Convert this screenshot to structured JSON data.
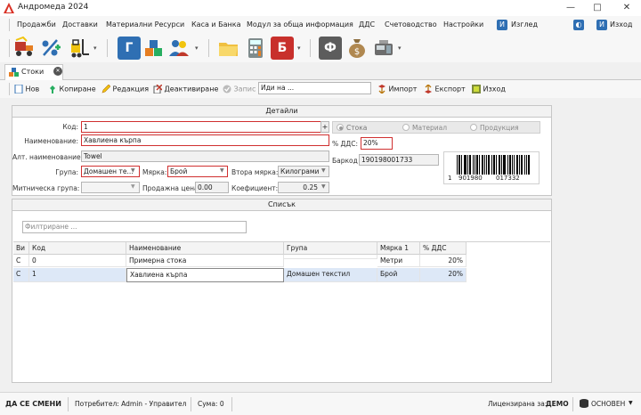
{
  "window": {
    "title": "Андромеда 2024",
    "minimize": "—",
    "maximize": "□",
    "close": "✕"
  },
  "menu": {
    "items": [
      "Продажби",
      "Доставки",
      "Материални Ресурси",
      "Каса и Банка",
      "Модул за обща информация",
      "ДДС",
      "Счетоводство",
      "Настройки"
    ],
    "view_label": "Изглед",
    "exit_label": "Изход"
  },
  "toolbar": {
    "g_letter": "Г",
    "b_letter": "Б",
    "f_letter": "Ф",
    "dropdown": "▾"
  },
  "tab": {
    "label": "Стоки",
    "close": "✕"
  },
  "actions": {
    "new": "Нов",
    "copy": "Копиране",
    "edit": "Редакция",
    "deactivate": "Деактивиране",
    "save": "Запис",
    "search_placeholder": "Иди на ...",
    "import": "Импорт",
    "export": "Експорт",
    "exit": "Изход"
  },
  "details": {
    "title": "Детайли",
    "code_label": "Код:",
    "code_value": "1",
    "name_label": "Наименование:",
    "name_value": "Хавлиена кърпа",
    "alt_name_label": "Алт. наименование:",
    "alt_name_value": "Towel",
    "group_label": "Група:",
    "group_value": "Домашен те...",
    "unit_label": "Мярка:",
    "unit_value": "Брой",
    "second_unit_label": "Втора мярка:",
    "second_unit_value": "Килограми",
    "customs_group_label": "Митническа група:",
    "customs_group_value": "",
    "sale_price_label": "Продажна цена",
    "sale_price_value": "0.00",
    "coef_label": "Коефициент:",
    "coef_value": "0.25",
    "type_options": [
      "Стока",
      "Материал",
      "Продукция"
    ],
    "type_selected": 0,
    "vat_label": "% ДДС:",
    "vat_value": "20%",
    "barcode_label": "Баркод",
    "barcode_value": "190198001733",
    "barcode_text_1": "1",
    "barcode_text_2": "901980",
    "barcode_text_3": "017332"
  },
  "list": {
    "title": "Списък",
    "filter_placeholder": "Филтриране ...",
    "columns": [
      "Ви",
      "Код",
      "Наименование",
      "Група",
      "Мярка 1",
      "% ДДС"
    ],
    "rows": [
      [
        "С",
        "0",
        "Примерна стока",
        "",
        "Метри",
        "20%"
      ],
      [
        "С",
        "1",
        "Хавлиена кърпа",
        "Домашен текстил",
        "Брой",
        "20%"
      ]
    ]
  },
  "status": {
    "change": "ДА СЕ СМЕНИ",
    "user": "Потребител: Admin - Управител",
    "sum": "Сума: 0",
    "license_label": "Лицензирана за:",
    "license_value": "ДЕМО",
    "db": "ОСНОВЕН"
  },
  "colors": {
    "accent_red": "#d03030",
    "blue_tile": "#2f6fb3",
    "red_tile": "#c8302c",
    "gray_tile": "#5c5c5c",
    "row_selected": "#dde8f7"
  }
}
